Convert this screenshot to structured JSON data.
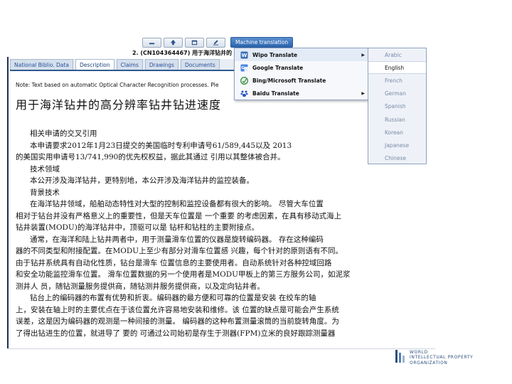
{
  "toolbar": {
    "buttons": [
      {
        "icon": "minimize-icon"
      },
      {
        "icon": "up-arrow-icon"
      },
      {
        "icon": "restore-icon"
      },
      {
        "icon": "edit-icon"
      }
    ],
    "machine_translation_label": "Machine translation"
  },
  "document": {
    "title": "2. (CN104364467) 用于海洋钻井的"
  },
  "tabs": [
    {
      "label": "National Biblio. Data",
      "active": false
    },
    {
      "label": "Description",
      "active": true
    },
    {
      "label": "Claims",
      "active": false
    },
    {
      "label": "Drawings",
      "active": false
    },
    {
      "label": "Documents",
      "active": false
    }
  ],
  "note": "Note: Text based on automatic Optical Character Recognition processes. Ple",
  "heading": "用于海洋钻井的高分辨率钻井钻进速度",
  "body_lines": [
    "      相关申请的交叉引用",
    "      本申请要求2012年1月23日提交的美国临时专利申请号61/589,445以及 2013",
    "的美国实用申请号13/741,990的优先权权益，据此其通过 引用以其整体被合并。",
    "      技术领域",
    "      本公开涉及海洋钻井，更特别地，本公开涉及海洋钻井的监控装备。",
    "      背景技术",
    "      在海洋钻井领域，船舶动态特性对大型的控制和监控设备都有很大的影响。 尽管大车位置",
    "相对于钻台并没有严格意义上的重要性，但是天车位置是 一个重要 的考虑因素，在具有移动式海上",
    "钻井装置(MODU)的海洋钻井中，顶驱可以是 钻杆和钻柱的主要附接点。",
    "      通常，在海洋和陆上钻井两者中，用于测量滑车位置的仪器是旋转编码器。 存在这种编码",
    "器的不同类型和附接配置。在MODU上至少有部分对滑车位置感 兴趣，每个针对的原则语有不同。",
    "由于钻井系统具有自动化性质，钻台是滑车 位置信息的主要使用者。自动系统针对各种控域回路",
    "和安全功能监控滑车位置。 滑车位置数据的另一个使用者是MODU甲板上的第三方服务公司，如泥浆",
    "测井人 员，随钻测量服务提供商，随钻测井服务提供商，以及定向钻井者。",
    "      钻台上的编码器的布置有优势和折衷。编码器的最方便和可靠的位置是安装 在绞车的轴",
    "上，安装在轴上时的主要优点在于该位置允许容易地安装和维修。该 位置的缺点是可能会产生系统",
    "误差，这是因为编码器的观测是一种间接的测量。 编码器的这种布置测量滚筒的当前旋转角度。为",
    "了得出钻进生的位置，就进导了 要的 可通过公司始初是存生于测器(FPM)立米的良好跟踪测量器"
  ],
  "context_menu": {
    "items": [
      {
        "label": "Wipo Translate",
        "icon": "wipo-translate-icon",
        "has_submenu": true
      },
      {
        "label": "Google Translate",
        "icon": "google-translate-icon",
        "has_submenu": false
      },
      {
        "label": "Bing/Microsoft Translate",
        "icon": "bing-translate-icon",
        "has_submenu": false
      },
      {
        "label": "Baidu Translate",
        "icon": "baidu-translate-icon",
        "has_submenu": true
      }
    ]
  },
  "language_submenu": {
    "items": [
      {
        "label": "Arabic",
        "selected": false
      },
      {
        "label": "English",
        "selected": true
      },
      {
        "label": "French",
        "selected": false
      },
      {
        "label": "German",
        "selected": false
      },
      {
        "label": "Spanish",
        "selected": false
      },
      {
        "label": "Russian",
        "selected": false
      },
      {
        "label": "Korean",
        "selected": false
      },
      {
        "label": "Japanese",
        "selected": false
      },
      {
        "label": "Chinese",
        "selected": false
      }
    ]
  },
  "footer": {
    "org_lines": [
      "WORLD",
      "INTELLECTUAL PROPERTY",
      "ORGANIZATION"
    ]
  },
  "colors": {
    "accent": "#2e5a91",
    "tab_text": "#27509a",
    "menu_border": "#8ea3c2"
  }
}
